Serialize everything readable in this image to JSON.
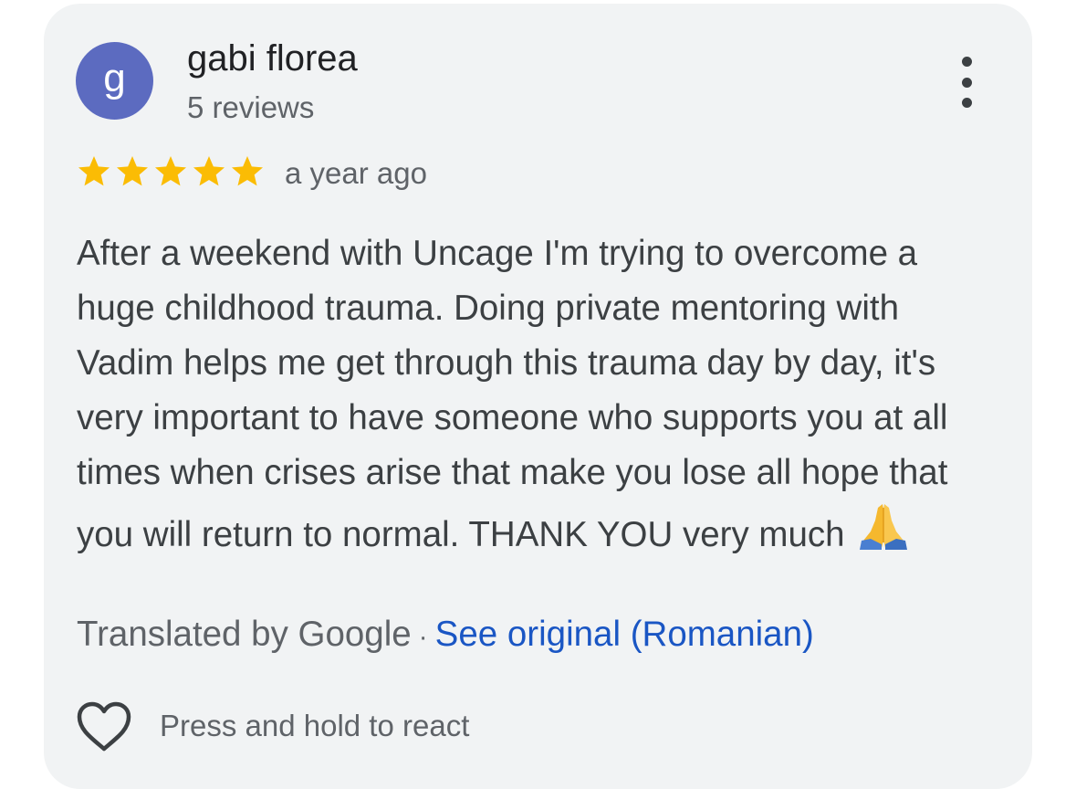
{
  "review": {
    "author": {
      "initial": "g",
      "name": "gabi florea",
      "reviews": "5 reviews",
      "avatar_color": "#5c6bc0"
    },
    "rating": 5,
    "star_color": "#fbbc04",
    "time_ago": "a year ago",
    "text": "After a weekend with Uncage I'm trying to overcome a huge childhood trauma. Doing private mentoring with Vadim helps me get through this trauma day by day, it's very important to have someone who supports you at all times when crises arise that make you lose all hope that you will return to normal. THANK YOU very much",
    "emoji": "folded-hands",
    "translated_by": "Translated by Google",
    "separator": "·",
    "see_original": "See original (Romanian)",
    "link_color": "#1a56c4",
    "react_label": "Press and hold to react"
  },
  "icons": {
    "more": "more-vertical-icon",
    "star": "star-icon",
    "heart": "heart-outline-icon"
  }
}
